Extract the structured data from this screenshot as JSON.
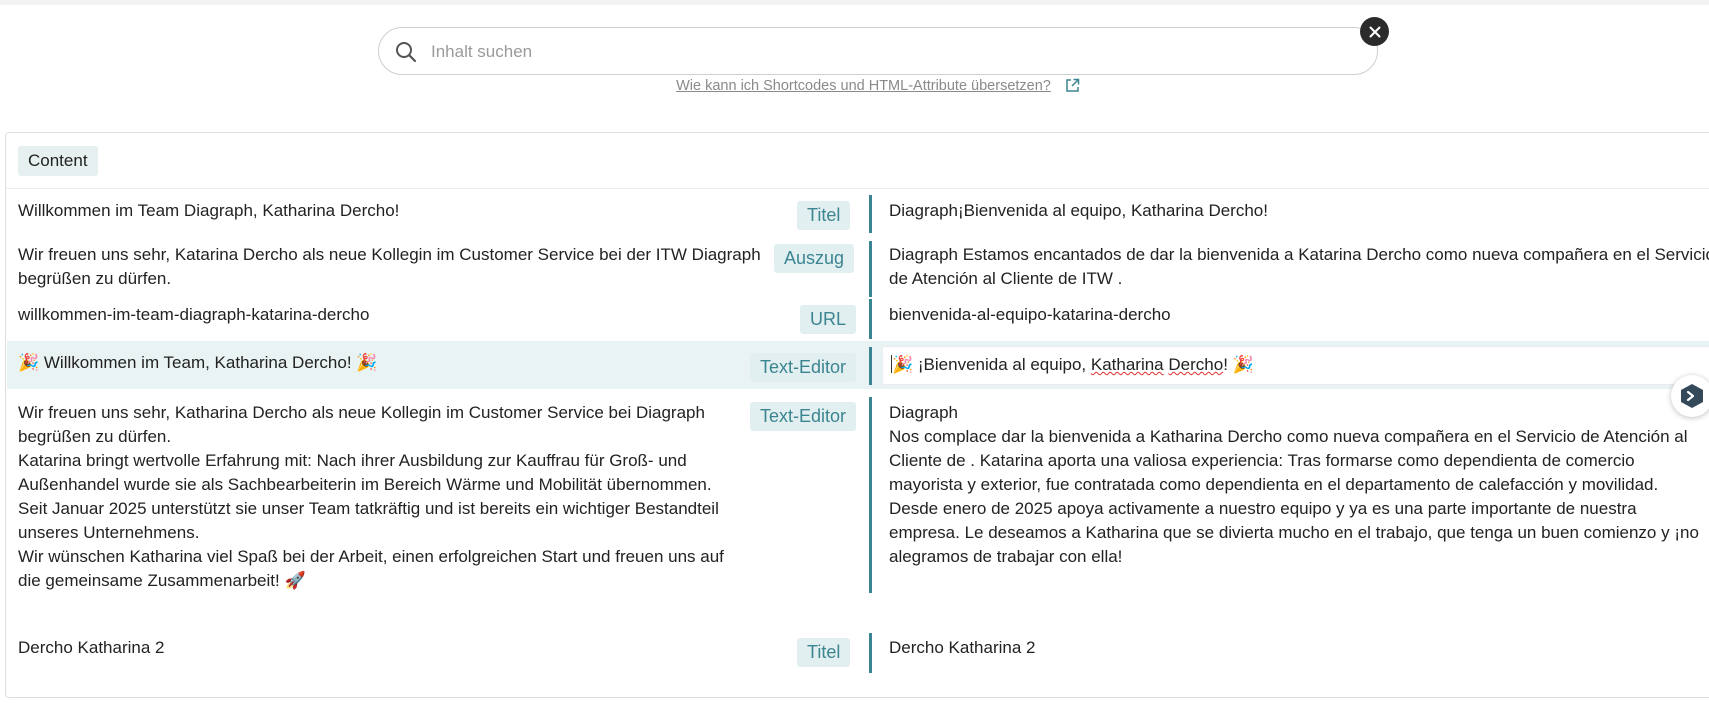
{
  "search": {
    "placeholder": "Inhalt suchen",
    "value": "",
    "help_link": "Wie kann ich Shortcodes und HTML-Attribute übersetzen?"
  },
  "panel": {
    "header_tag": "Content"
  },
  "rows": [
    {
      "source": "Willkommen im Team Diagraph, Katharina Dercho!",
      "tag": "Titel",
      "target": "Diagraph¡Bienvenida al equipo, Katharina Dercho!"
    },
    {
      "source": "Wir freuen uns sehr, Katarina Dercho als neue Kollegin im Customer Service bei der ITW Diagraph begrüßen zu dürfen.",
      "tag": "Auszug",
      "target": "Diagraph Estamos encantados de dar la bienvenida a Katarina Dercho como nueva compañera en el Servicio de Atención al Cliente de ITW ."
    },
    {
      "source": "willkommen-im-team-diagraph-katarina-dercho",
      "tag": "URL",
      "target": "bienvenida-al-equipo-katarina-dercho"
    },
    {
      "source": "🎉 Willkommen im Team, Katharina Dercho! 🎉",
      "tag": "Text-Editor",
      "target_parts": {
        "emoji_start": "🎉",
        "text_a": " ¡Bienvenida al equipo, ",
        "word_1": "Katharina",
        "space": " ",
        "word_2": "Dercho",
        "text_b": "! ",
        "emoji_end": "🎉"
      }
    },
    {
      "source": "Wir freuen uns sehr, Katharina Dercho als neue Kollegin im Customer Service bei Diagraph\nbegrüßen zu dürfen.\nKatarina bringt wertvolle Erfahrung mit: Nach ihrer Ausbildung zur Kauffrau für Groß- und\nAußenhandel wurde sie als Sachbearbeiterin im Bereich Wärme und Mobilität übernommen.\nSeit Januar 2025 unterstützt sie unser Team tatkräftig und ist bereits ein wichtiger Bestandteil\nunseres Unternehmens.\nWir wünschen Katharina viel Spaß bei der Arbeit, einen erfolgreichen Start und freuen uns auf\ndie gemeinsame Zusammenarbeit! 🚀",
      "tag": "Text-Editor",
      "target": "Diagraph\nNos complace dar la bienvenida a Katharina Dercho como nueva compañera en el Servicio de Atención al\nCliente de . Katarina aporta una valiosa experiencia: Tras formarse como dependienta de comercio\nmayorista y exterior, fue contratada como dependienta en el departamento de calefacción y movilidad.\nDesde enero de 2025 apoya activamente a nuestro equipo y ya es una parte importante de nuestra\nempresa. Le deseamos a Katharina que se divierta mucho en el trabajo, que tenga un buen comienzo y ¡no\nalegramos de trabajar con ella!"
    },
    {
      "source": "Dercho Katharina 2",
      "tag": "Titel",
      "target": "Dercho Katharina 2"
    }
  ],
  "colors": {
    "accent": "#3b8491",
    "tag_background": "#e2eff0",
    "row_highlight": "#eaf3f4"
  },
  "icons": [
    "search-icon",
    "close-icon",
    "external-link-icon",
    "assistant-icon"
  ]
}
